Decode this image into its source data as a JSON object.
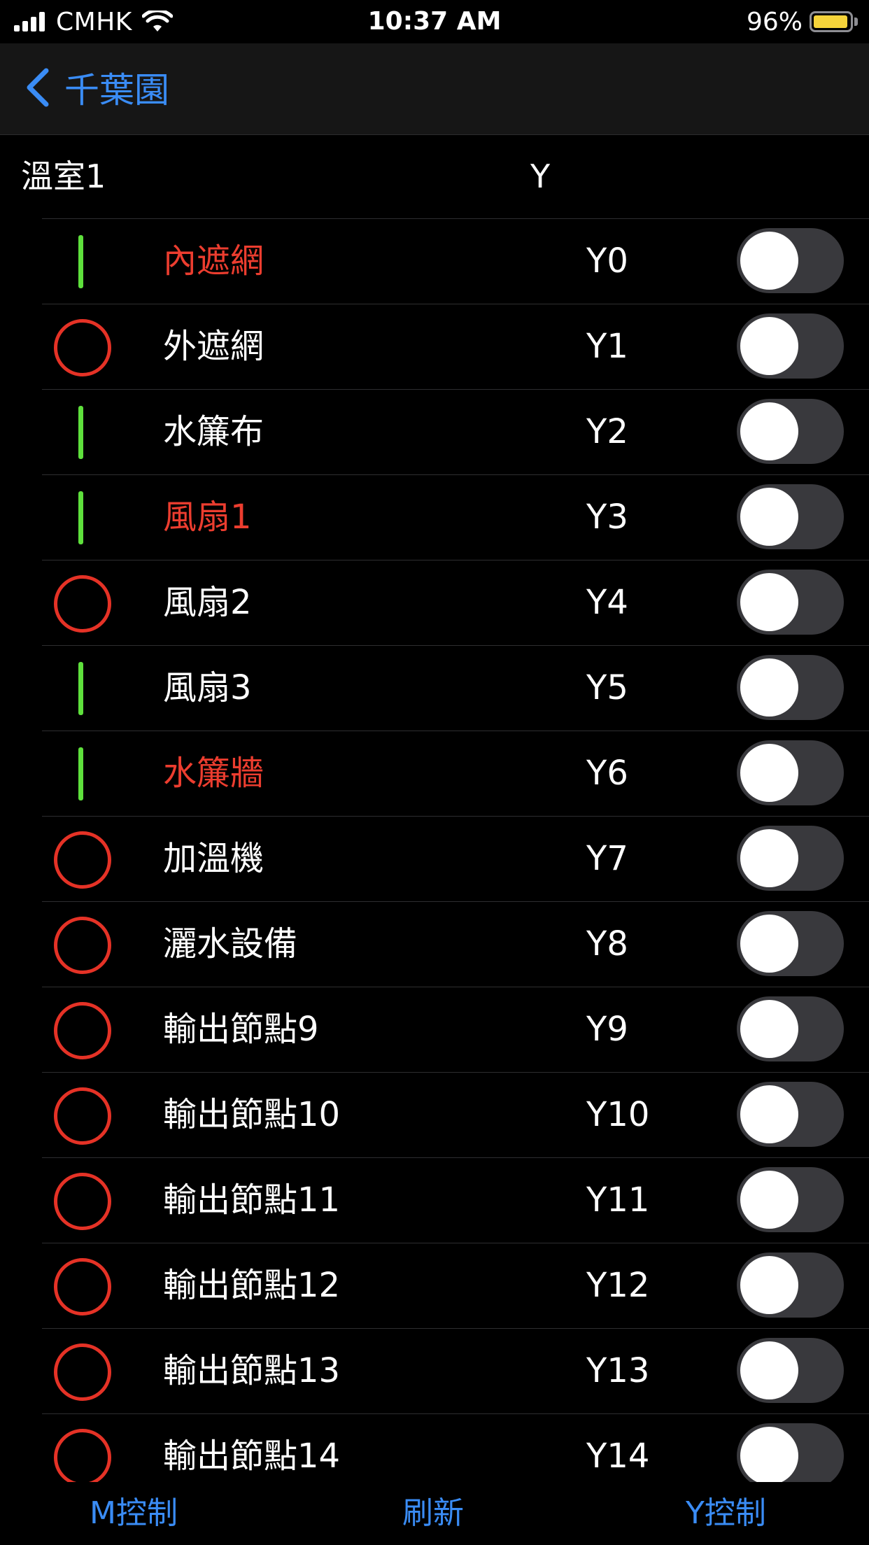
{
  "status_bar": {
    "carrier": "CMHK",
    "time": "10:37 AM",
    "battery": "96%",
    "battery_level": 0.96,
    "battery_color": "#f5d33a"
  },
  "nav": {
    "back_label": "千葉園",
    "accent": "#3a8cf5"
  },
  "section": {
    "title": "溫室1",
    "column_header": "Y"
  },
  "rows": [
    {
      "name": "內遮網",
      "address": "Y0",
      "indicator": "green-bar",
      "highlight": true,
      "switch_on": false
    },
    {
      "name": "外遮網",
      "address": "Y1",
      "indicator": "red-circle",
      "highlight": false,
      "switch_on": false
    },
    {
      "name": "水簾布",
      "address": "Y2",
      "indicator": "green-bar",
      "highlight": false,
      "switch_on": false
    },
    {
      "name": "風扇1",
      "address": "Y3",
      "indicator": "green-bar",
      "highlight": true,
      "switch_on": false
    },
    {
      "name": "風扇2",
      "address": "Y4",
      "indicator": "red-circle",
      "highlight": false,
      "switch_on": false
    },
    {
      "name": "風扇3",
      "address": "Y5",
      "indicator": "green-bar",
      "highlight": false,
      "switch_on": false
    },
    {
      "name": "水簾牆",
      "address": "Y6",
      "indicator": "green-bar",
      "highlight": true,
      "switch_on": false
    },
    {
      "name": "加溫機",
      "address": "Y7",
      "indicator": "red-circle",
      "highlight": false,
      "switch_on": false
    },
    {
      "name": "灑水設備",
      "address": "Y8",
      "indicator": "red-circle",
      "highlight": false,
      "switch_on": false
    },
    {
      "name": "輸出節點9",
      "address": "Y9",
      "indicator": "red-circle",
      "highlight": false,
      "switch_on": false
    },
    {
      "name": "輸出節點10",
      "address": "Y10",
      "indicator": "red-circle",
      "highlight": false,
      "switch_on": false
    },
    {
      "name": "輸出節點11",
      "address": "Y11",
      "indicator": "red-circle",
      "highlight": false,
      "switch_on": false
    },
    {
      "name": "輸出節點12",
      "address": "Y12",
      "indicator": "red-circle",
      "highlight": false,
      "switch_on": false
    },
    {
      "name": "輸出節點13",
      "address": "Y13",
      "indicator": "red-circle",
      "highlight": false,
      "switch_on": false
    },
    {
      "name": "輸出節點14",
      "address": "Y14",
      "indicator": "red-circle",
      "highlight": false,
      "switch_on": false
    }
  ],
  "toolbar": {
    "m_control": "M控制",
    "refresh": "刷新",
    "y_control": "Y控制"
  },
  "colors": {
    "status_on_bar": "#5ee03c",
    "status_off_circle": "#e53226",
    "highlight_text": "#ec3d2f"
  }
}
